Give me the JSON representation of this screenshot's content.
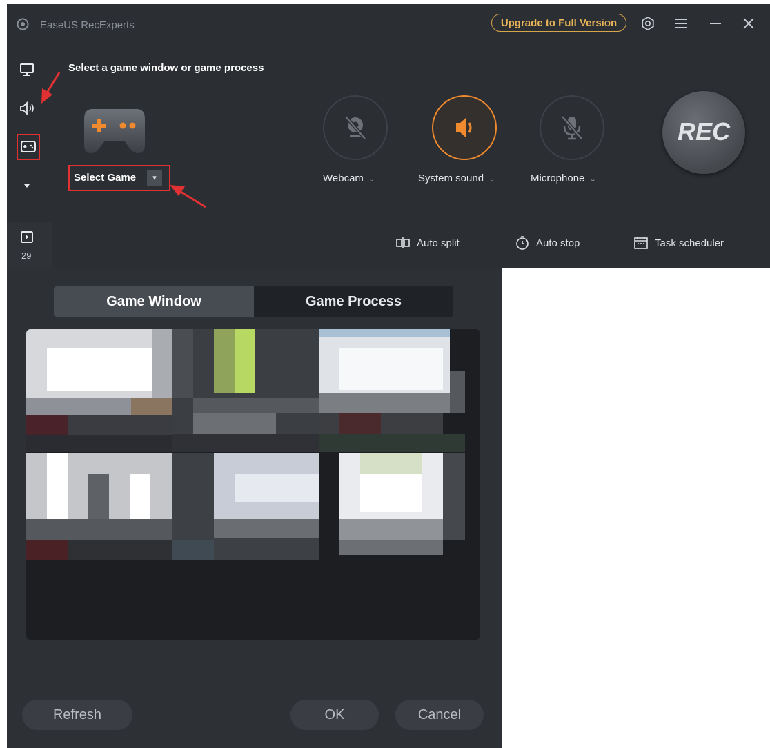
{
  "app": {
    "title": "EaseUS RecExperts",
    "upgrade_label": "Upgrade to Full Version",
    "window_controls": [
      "settings-icon",
      "menu-icon",
      "minimize-icon",
      "close-icon"
    ]
  },
  "sidebar": {
    "items": [
      "monitor-icon",
      "audio-icon",
      "gamepad-icon",
      "dropdown-arrow-icon"
    ],
    "media_count": "29"
  },
  "game_mode": {
    "instruction": "Select a game window or game process",
    "select_label": "Select Game"
  },
  "media_controls": {
    "webcam": {
      "label": "Webcam",
      "state": "off"
    },
    "system_sound": {
      "label": "System sound",
      "state": "on"
    },
    "microphone": {
      "label": "Microphone",
      "state": "off"
    }
  },
  "rec": {
    "label": "REC"
  },
  "bottom_bar": {
    "auto_split": "Auto split",
    "auto_stop": "Auto stop",
    "task_scheduler": "Task scheduler"
  },
  "dialog": {
    "tabs": [
      "Game Window",
      "Game Process"
    ],
    "active_tab": "Game Window",
    "buttons": {
      "refresh": "Refresh",
      "ok": "OK",
      "cancel": "Cancel"
    }
  },
  "colors": {
    "accent_orange": "#f08a2e",
    "upgrade_gold": "#e7b458",
    "highlight_red": "#e03232",
    "panel_bg": "#2b2e33"
  }
}
